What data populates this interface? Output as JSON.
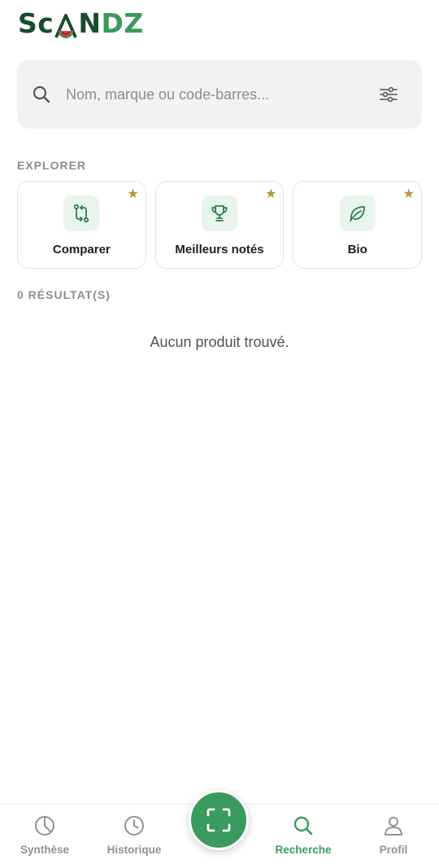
{
  "app": {
    "logo_parts": [
      "Sc",
      "A",
      "N",
      "DZ"
    ]
  },
  "search": {
    "placeholder": "Nom, marque ou code-barres...",
    "value": ""
  },
  "explore": {
    "heading": "EXPLORER",
    "cards": [
      {
        "label": "Comparer",
        "icon": "compare-arrows-icon",
        "starred": true
      },
      {
        "label": "Meilleurs notés",
        "icon": "trophy-icon",
        "starred": true
      },
      {
        "label": "Bio",
        "icon": "leaf-icon",
        "starred": true
      }
    ],
    "star_glyph": "★"
  },
  "results": {
    "count_label": "0 RÉSULTAT(S)",
    "empty_message": "Aucun produit trouvé."
  },
  "nav": {
    "items": [
      {
        "label": "Synthèse",
        "icon": "pie-chart-icon",
        "active": false
      },
      {
        "label": "Historique",
        "icon": "clock-icon",
        "active": false
      },
      {
        "label": "Recherche",
        "icon": "search-icon",
        "active": true
      },
      {
        "label": "Profil",
        "icon": "user-icon",
        "active": false
      }
    ],
    "scan_icon": "scan-frame-icon"
  },
  "colors": {
    "brand_dark": "#184d2c",
    "brand_green": "#3b9a5e",
    "star": "#b8933a",
    "muted": "#8e9391"
  }
}
